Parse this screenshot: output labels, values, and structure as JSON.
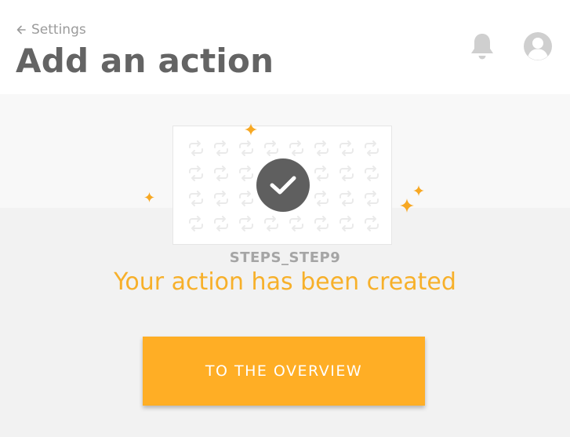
{
  "header": {
    "back_label": "Settings",
    "title": "Add an action"
  },
  "icons": {
    "back": "arrow-left-icon",
    "notifications": "bell-icon",
    "profile": "user-avatar-icon",
    "pattern": "repeat-icon",
    "success": "checkmark-icon",
    "decoration": "sparkle-icon"
  },
  "confirmation": {
    "step_id": "STEPS_STEP9",
    "message": "Your action has been created"
  },
  "actions": {
    "overview_label": "TO THE OVERVIEW"
  },
  "colors": {
    "accent": "#ffae25",
    "message": "#f7b02a",
    "title": "#646464",
    "muted": "#a5a5a5",
    "badge": "#5f5f5f"
  }
}
